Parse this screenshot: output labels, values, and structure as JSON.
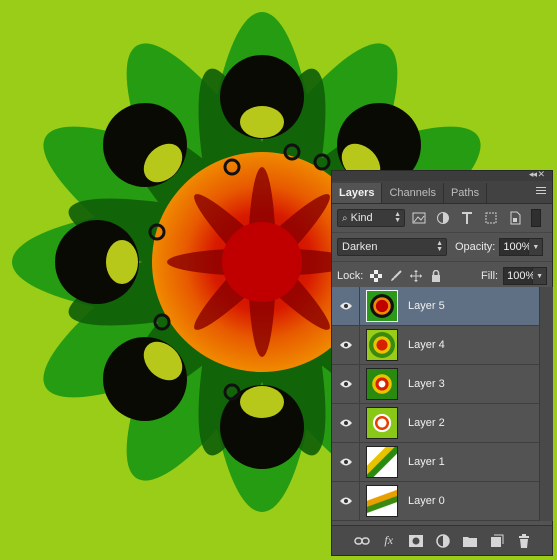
{
  "panel": {
    "tabs": [
      {
        "label": "Layers",
        "active": true
      },
      {
        "label": "Channels",
        "active": false
      },
      {
        "label": "Paths",
        "active": false
      }
    ],
    "filter_kind": "Kind",
    "blend_mode": "Darken",
    "opacity_label": "Opacity:",
    "opacity_value": "100%",
    "lock_label": "Lock:",
    "fill_label": "Fill:",
    "fill_value": "100%",
    "layers": [
      {
        "name": "Layer 5",
        "selected": true
      },
      {
        "name": "Layer 4",
        "selected": false
      },
      {
        "name": "Layer 3",
        "selected": false
      },
      {
        "name": "Layer 2",
        "selected": false
      },
      {
        "name": "Layer 1",
        "selected": false
      },
      {
        "name": "Layer 0",
        "selected": false
      }
    ],
    "bottom_icons": [
      "link-icon",
      "fx-icon",
      "mask-icon",
      "adjustment-icon",
      "folder-icon",
      "new-layer-icon",
      "trash-icon"
    ],
    "bottom_fx_label": "fx"
  },
  "colors": {
    "background_green": "#9acd18",
    "panel_gray": "#535353",
    "selected_row": "#5f6f84"
  }
}
